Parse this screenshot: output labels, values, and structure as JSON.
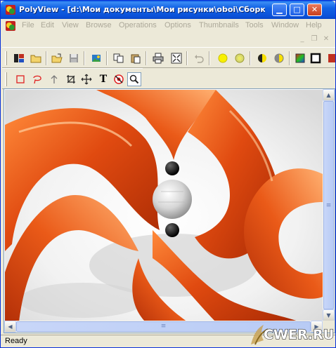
{
  "window": {
    "title": "PolyView - [d:\\Мои документы\\Мои рисунки\\oboi\\Сборка об...",
    "controls": {
      "minimize": "▁",
      "maximize": "□",
      "close": "✕"
    }
  },
  "menubar": {
    "items": [
      {
        "label": "File"
      },
      {
        "label": "Edit"
      },
      {
        "label": "View"
      },
      {
        "label": "Browse"
      },
      {
        "label": "Operations"
      },
      {
        "label": "Options"
      },
      {
        "label": "Thumbnails"
      },
      {
        "label": "Tools"
      },
      {
        "label": "Window"
      },
      {
        "label": "Help"
      }
    ],
    "mdi_controls": {
      "minimize": "_",
      "restore": "❐",
      "close": "✕"
    }
  },
  "toolbar_main": {
    "tools": [
      {
        "icon": "thumbnail-browse-icon"
      },
      {
        "icon": "open-folder-icon"
      },
      {
        "icon": "open-file-icon"
      },
      {
        "icon": "save-icon"
      },
      {
        "icon": "acquire-image-icon"
      },
      {
        "icon": "copy-icon"
      },
      {
        "icon": "paste-icon"
      },
      {
        "icon": "print-icon"
      },
      {
        "icon": "fit-to-window-icon"
      },
      {
        "icon": "undo-icon"
      },
      {
        "icon": "brightness-increase-icon"
      },
      {
        "icon": "brightness-decrease-icon"
      },
      {
        "icon": "contrast-increase-icon"
      },
      {
        "icon": "contrast-decrease-icon"
      },
      {
        "icon": "color-balance-icon"
      },
      {
        "icon": "frame-icon"
      },
      {
        "icon": "extra-tool-icon"
      }
    ]
  },
  "toolbar_tools": {
    "tools": [
      {
        "icon": "rectangle-select-icon"
      },
      {
        "icon": "lasso-select-icon"
      },
      {
        "icon": "arrow-icon"
      },
      {
        "icon": "crop-icon"
      },
      {
        "icon": "move-icon"
      },
      {
        "icon": "text-tool-icon",
        "label": "T"
      },
      {
        "icon": "red-eye-icon"
      },
      {
        "icon": "zoom-icon",
        "pressed": true
      }
    ]
  },
  "image_view": {
    "description_icon": "wallpaper-image"
  },
  "scrollbars": {
    "up": "▲",
    "down": "▼",
    "left": "◀",
    "right": "▶",
    "grip": "≡"
  },
  "statusbar": {
    "text": "Ready"
  },
  "watermark": {
    "text": "CWER.RU"
  },
  "colors": {
    "title_blue": "#0a58e4",
    "chrome": "#ece9d8",
    "accent_orange": "#e0501a"
  }
}
